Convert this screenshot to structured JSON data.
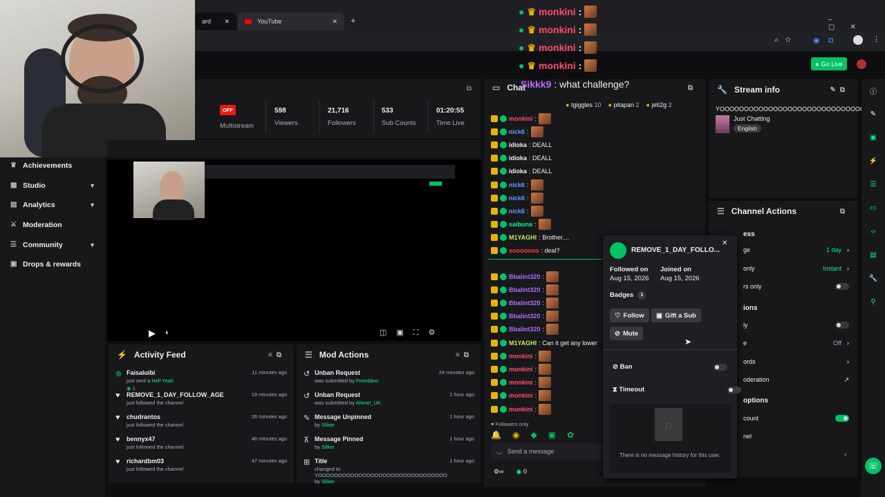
{
  "browser": {
    "tab1_title": "ard",
    "tab2_title": "YouTube",
    "go_live_label": "Go Live"
  },
  "sidebar": {
    "items": [
      {
        "label": "Achievements",
        "chevron": false
      },
      {
        "label": "Studio",
        "chevron": true
      },
      {
        "label": "Analytics",
        "chevron": true
      },
      {
        "label": "Moderation",
        "chevron": false
      },
      {
        "label": "Community",
        "chevron": true
      },
      {
        "label": "Drops & rewards",
        "chevron": false
      }
    ]
  },
  "stats": {
    "multistream_badge": "OFF",
    "multistream_label": "Multistream",
    "viewers_value": "598",
    "viewers_label": "Viewers",
    "followers_value": "21,716",
    "followers_label": "Followers",
    "subs_value": "533",
    "subs_label": "Sub Counts",
    "time_value": "01:20:55",
    "time_label": "Time Live"
  },
  "activity_feed": {
    "title": "Activity Feed",
    "items": [
      {
        "name": "Faisaluibi",
        "desc": "just sent a",
        "extra": "Hell Yeah",
        "count": "1",
        "time": "11 minutes ago",
        "icon": "gift"
      },
      {
        "name": "REMOVE_1_DAY_FOLLOW_AGE",
        "desc": "just followed the channel",
        "extra": "",
        "count": "",
        "time": "19 minutes ago",
        "icon": "heart"
      },
      {
        "name": "chudrantos",
        "desc": "just followed the channel",
        "extra": "",
        "count": "",
        "time": "26 minutes ago",
        "icon": "heart"
      },
      {
        "name": "bennyx47",
        "desc": "just followed the channel",
        "extra": "",
        "count": "",
        "time": "46 minutes ago",
        "icon": "heart"
      },
      {
        "name": "richardbm03",
        "desc": "just followed the channel",
        "extra": "",
        "count": "",
        "time": "47 minutes ago",
        "icon": "heart"
      }
    ]
  },
  "mod_actions": {
    "title": "Mod Actions",
    "items": [
      {
        "title": "Unban Request",
        "desc": "was submitted by",
        "who": "Freeddoo",
        "time": "24 minutes ago"
      },
      {
        "title": "Unban Request",
        "desc": "was submitted by",
        "who": "Ahmet_UK",
        "time": "1 hour ago"
      },
      {
        "title": "Message Unpinned",
        "desc": "by",
        "who": "Sliker",
        "time": "1 hour ago"
      },
      {
        "title": "Message Pinned",
        "desc": "by",
        "who": "Sliker",
        "time": "1 hour ago"
      },
      {
        "title": "Title",
        "desc": "changed to YOOOOOOOOOOOOOOOOOOOOOOOOOOOOOOOO by",
        "who": "Sliker",
        "time": "1 hour ago"
      }
    ]
  },
  "chat": {
    "title": "Chat",
    "top_gifters": [
      {
        "name": "tgiggles",
        "count": "10"
      },
      {
        "name": "pitapan",
        "count": "2"
      },
      {
        "name": "jeti2g",
        "count": "2"
      }
    ],
    "messages": [
      {
        "user": "monkini",
        "text": ":",
        "color": "#ff4a6e",
        "emote": true
      },
      {
        "user": "nick6",
        "text": ":",
        "color": "#5aa0ff",
        "emote": true
      },
      {
        "user": "idioka",
        "text": ": DEALL",
        "color": "#efeff1",
        "emote": false
      },
      {
        "user": "idioka",
        "text": ": DEALL",
        "color": "#efeff1",
        "emote": false
      },
      {
        "user": "idioka",
        "text": ": DEALL",
        "color": "#efeff1",
        "emote": false
      },
      {
        "user": "nick6",
        "text": ":",
        "color": "#5aa0ff",
        "emote": true
      },
      {
        "user": "nick6",
        "text": ":",
        "color": "#5aa0ff",
        "emote": true
      },
      {
        "user": "nick6",
        "text": ":",
        "color": "#5aa0ff",
        "emote": true
      },
      {
        "user": "saibuna",
        "text": ":",
        "color": "#00f593",
        "emote": true
      },
      {
        "user": "M1YAGHI",
        "text": ": Brother....",
        "color": "#c8e85a",
        "emote": false
      },
      {
        "user": "xooooooo",
        "text": ": deal?",
        "color": "#ff3b3b",
        "emote": false
      }
    ],
    "new_messages_label": "New me",
    "messages_after": [
      {
        "user": "Bbalint320",
        "text": ":",
        "color": "#b36bff",
        "emote": true
      },
      {
        "user": "Bbalint320",
        "text": ":",
        "color": "#b36bff",
        "emote": true
      },
      {
        "user": "Bbalint320",
        "text": ":",
        "color": "#b36bff",
        "emote": true
      },
      {
        "user": "Bbalint320",
        "text": ":",
        "color": "#b36bff",
        "emote": true
      },
      {
        "user": "Bbalint320",
        "text": ":",
        "color": "#b36bff",
        "emote": true
      },
      {
        "user": "M1YAGHI",
        "text": ": Can it get any lower",
        "color": "#c8e85a",
        "emote": false
      },
      {
        "user": "monkini",
        "text": ":",
        "color": "#ff4a6e",
        "emote": true
      },
      {
        "user": "monkini",
        "text": ":",
        "color": "#ff4a6e",
        "emote": true
      },
      {
        "user": "monkini",
        "text": ":",
        "color": "#ff4a6e",
        "emote": true
      },
      {
        "user": "monkini",
        "text": ":",
        "color": "#ff4a6e",
        "emote": true
      },
      {
        "user": "monkini",
        "text": ":",
        "color": "#ff4a6e",
        "emote": true
      }
    ],
    "followers_only": "Followers only",
    "input_placeholder": "Send a message",
    "points": "0"
  },
  "overlay": {
    "lines": [
      {
        "user": "monkini",
        "text": ":",
        "color": "#ff4a6e"
      },
      {
        "user": "monkini",
        "text": ":",
        "color": "#ff4a6e"
      },
      {
        "user": "monkini",
        "text": ":",
        "color": "#ff4a6e"
      },
      {
        "user": "monkini",
        "text": ":",
        "color": "#ff4a6e"
      }
    ],
    "question_user": "Sikkk9",
    "question_text": ": what challenge?"
  },
  "stream_info": {
    "title": "Stream info",
    "stream_title": "YOOOOOOOOOOOOOOOOOOOOOOOOOOOOOO",
    "category": "Just Chatting",
    "language": "English"
  },
  "channel_actions": {
    "title": "Channel Actions",
    "section1": "ess",
    "row1_label": "ge",
    "row1_value": "1 day",
    "row2_label": "only",
    "row2_value": "Instant",
    "row3_label": "rs only",
    "section2": "ions",
    "row4_label": "ly",
    "row5_label": "e",
    "row5_value": "Off",
    "row6_label": "ords",
    "row7_label": "oderation",
    "section3": "options",
    "row8_label": "count",
    "row9_label": "nel"
  },
  "user_card": {
    "username": "REMOVE_1_DAY_FOLLO...",
    "followed_label": "Followed on",
    "followed_date": "Aug 15, 2026",
    "joined_label": "Joined on",
    "joined_date": "Aug 15, 2026",
    "badges_label": "Badges",
    "badges_count": "1",
    "follow_label": "Follow",
    "gift_label": "Gift a Sub",
    "mute_label": "Mute",
    "ban_label": "Ban",
    "timeout_label": "Timeout",
    "empty_history": "There is no message history for this user."
  },
  "colors": {
    "accent": "#00f593",
    "panel": "#18181b",
    "background": "#0e0e10"
  }
}
